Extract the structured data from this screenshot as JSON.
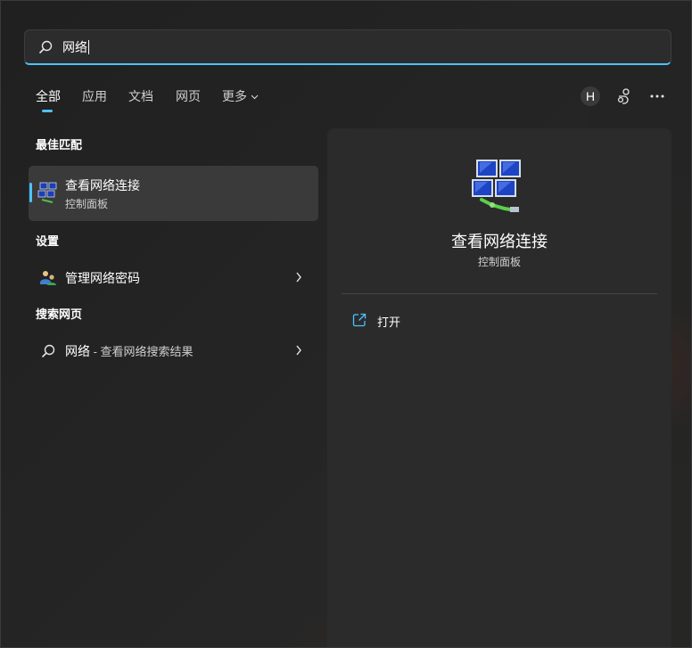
{
  "search": {
    "value": "网络"
  },
  "tabs": [
    {
      "label": "全部",
      "active": true
    },
    {
      "label": "应用"
    },
    {
      "label": "文档"
    },
    {
      "label": "网页"
    },
    {
      "label": "更多"
    }
  ],
  "header": {
    "avatar_initial": "H"
  },
  "sections": {
    "best_match": "最佳匹配",
    "settings": "设置",
    "web": "搜索网页"
  },
  "best_match": {
    "title": "查看网络连接",
    "subtitle": "控制面板"
  },
  "settings_items": [
    {
      "label": "管理网络密码"
    }
  ],
  "web_items": [
    {
      "query": "网络",
      "suffix": " - 查看网络搜索结果"
    }
  ],
  "detail": {
    "title": "查看网络连接",
    "subtitle": "控制面板",
    "actions": [
      {
        "label": "打开"
      }
    ]
  },
  "colors": {
    "accent": "#4cc2ff",
    "selected_bg": "#3a3a3a",
    "panel_bg": "#2b2b2b"
  }
}
